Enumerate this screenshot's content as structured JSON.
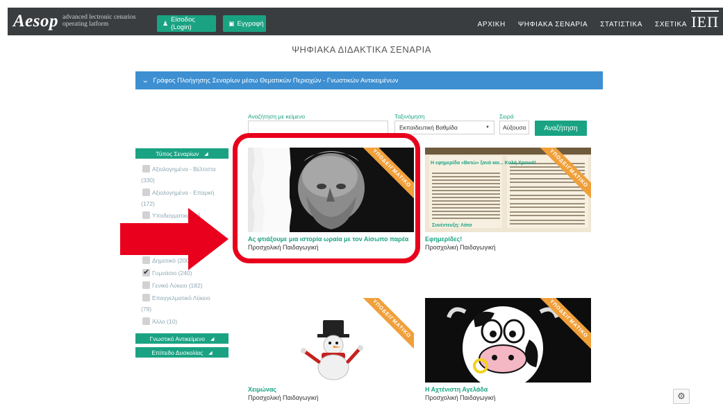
{
  "header": {
    "logo": "Aesop",
    "subtitle_lines": [
      "advanced lectronic cenarios",
      "operating latform"
    ],
    "login_label": "Είσοδος (Login)",
    "register_label": "Εγγραφή",
    "nav": [
      "ΑΡΧΙΚΗ",
      "ΨΗΦΙΑΚΑ ΣΕΝΑΡΙΑ",
      "ΣΤΑΤΙΣΤΙΚΑ",
      "ΣΧΕΤΙΚΑ"
    ],
    "iep_logo": "ΙΕΠ"
  },
  "page_title": "ΨΗΦΙΑΚΑ ΔΙΔΑΚΤΙΚΑ ΣΕΝΑΡΙΑ",
  "graph_bar": "Γράφος Πλοήγησης Σεναρίων μέσω Θεματικών Περιοχών - Γνωστικών Αντικειμένων",
  "search": {
    "text_label": "Αναζήτηση με κείμενο",
    "text_value": "",
    "sort_label": "Ταξινόμηση",
    "sort_value": "Εκπαιδευτική Βαθμίδα",
    "order_label": "Σειρά",
    "order_value": "Αύξουσα",
    "button_label": "Αναζήτηση"
  },
  "sidebar": {
    "type_heading": "Τύπος Σεναρίων",
    "type_items": [
      {
        "label": "Αξιολογημένα - Βέλτιστα",
        "count": "(330)"
      },
      {
        "label": "Αξιολογημένα - Επαρκή",
        "count": "(172)"
      },
      {
        "label": "Υποδειγματικά (26",
        "count": ""
      }
    ],
    "level_items": [
      {
        "label": "Δημοτικό (200)",
        "checked": false
      },
      {
        "label": "Γυμνάσιο (240)",
        "checked": true
      },
      {
        "label": "Γενικό Λύκειο (182)",
        "checked": false
      },
      {
        "label": "Επαγγελματικό Λύκειο",
        "count": "(79)",
        "checked": false
      },
      {
        "label": "Άλλο (10)",
        "checked": false
      }
    ],
    "subject_heading": "Γνωστικό Αντικείμενο",
    "difficulty_heading": "Επίπεδο Δυσκολίας"
  },
  "cards": [
    {
      "title": "Ας φτιάξουμε μια ιστορία ωραία με τον Αίσωπο παρέα",
      "category": "Προσχολική Παιδαγωγική",
      "ribbon": "ΥΠΟΔΕΙΓΜΑΤΙΚΟ"
    },
    {
      "title": "Εφημερίδες!",
      "category": "Προσχολική Παιδαγωγική",
      "ribbon": "ΥΠΟΔΕΙΓΜΑΤΙΚΟ",
      "newspaper_headline": "Η εφημερίδα «Βκτώ» ξανά και... Καλή Χρονιά!",
      "newspaper_sub": "Συνέντευξη: Λάτσ"
    },
    {
      "title": "Χειμώνας",
      "category": "Προσχολική Παιδαγωγική",
      "ribbon": "ΥΠΟΔΕΙΓΜΑΤΙΚΟ"
    },
    {
      "title": "Η Αχτένιστη Αγελάδα",
      "category": "Προσχολική Παιδαγωγική",
      "ribbon": "ΥΠΟΔΕΙΓΜΑΤΙΚΟ"
    }
  ],
  "colors": {
    "accent": "#1aa383",
    "navbar": "#3a3d3f",
    "bar": "#3d8fd1",
    "ribbon": "#f0a03b",
    "annotation": "#e8001c"
  }
}
